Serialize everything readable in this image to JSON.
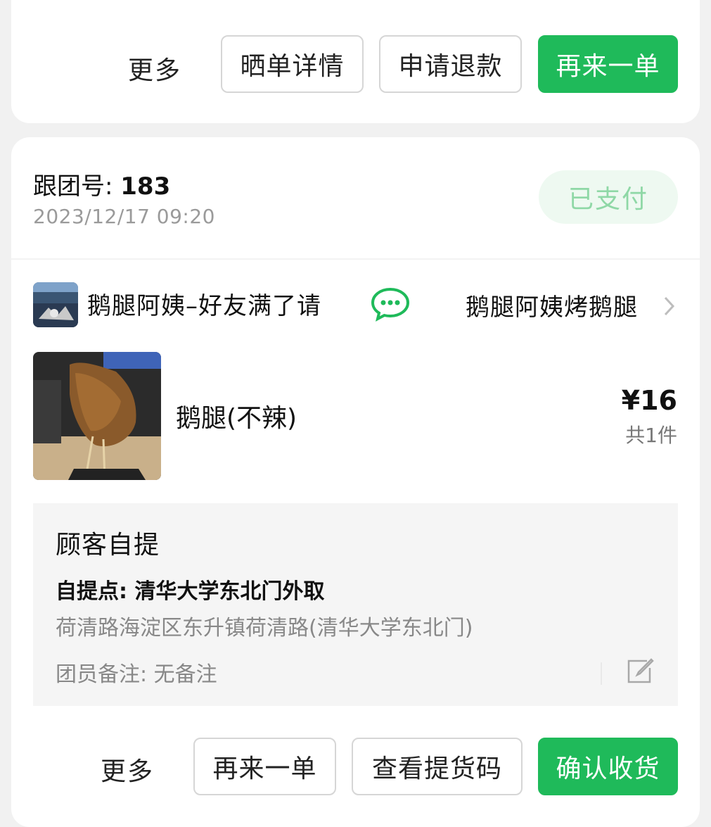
{
  "prev_order": {
    "actions": {
      "more": "更多",
      "review_detail": "晒单详情",
      "refund": "申请退款",
      "reorder": "再来一单"
    }
  },
  "order": {
    "group_label": "跟团号: ",
    "group_number": "183",
    "datetime": "2023/12/17 09:20",
    "status": "已支付",
    "shop_name": "鹅腿阿姨–好友满了请",
    "store_name": "鹅腿阿姨烤鹅腿",
    "product": {
      "name": "鹅腿(不辣)",
      "price": "¥16",
      "quantity": "共1件"
    },
    "pickup": {
      "title": "顾客自提",
      "point_label": "自提点: ",
      "point_name": "清华大学东北门外取",
      "address": "荷清路海淀区东升镇荷清路(清华大学东北门)",
      "note": "团员备注: 无备注"
    },
    "actions": {
      "more": "更多",
      "reorder": "再来一单",
      "view_code": "查看提货码",
      "confirm": "确认收货"
    }
  },
  "colors": {
    "accent_green": "#1fba5a",
    "badge_bg": "#eef9f1",
    "badge_text": "#8fd8a6"
  }
}
